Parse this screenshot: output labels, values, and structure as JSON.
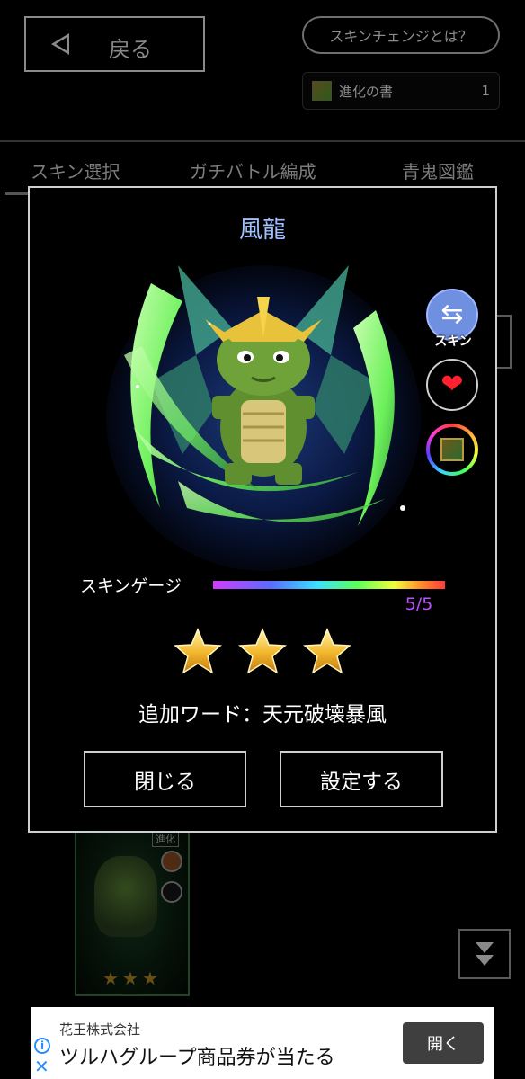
{
  "header": {
    "back_label": "戻る",
    "help_label": "スキンチェンジとは？",
    "item": {
      "name": "進化の書",
      "count": "1",
      "icon": "book-icon"
    }
  },
  "tabs": [
    "スキン選択",
    "ガチバトル編成",
    "青鬼図鑑"
  ],
  "background_card": {
    "tag": "進化",
    "stars": "★★★"
  },
  "modal": {
    "title": "風龍",
    "side_icons": {
      "skin": {
        "glyph": "⇆",
        "label": "スキン"
      },
      "heart": {
        "glyph": "❤"
      },
      "book": {
        "icon": "book-icon"
      }
    },
    "gauge": {
      "label": "スキンゲージ",
      "current": 5,
      "max": 5,
      "display": "5/5",
      "fill_fraction": 1.0
    },
    "stars": {
      "filled": 3,
      "total": 3
    },
    "added_word": "追加ワード：天元破壊暴風",
    "close_label": "閉じる",
    "set_label": "設定する"
  },
  "ad": {
    "company": "花王株式会社",
    "headline": "ツルハグループ商品券が当たる",
    "open_label": "開く",
    "info_icon": "i",
    "close_icon": "✕"
  },
  "colors": {
    "title_blue": "#9ec0ff",
    "gauge_value": "#c34cff",
    "star_gold": "#f2b52a",
    "dragon_green": "#6fa33a",
    "wind_green": "#7cff6a"
  }
}
